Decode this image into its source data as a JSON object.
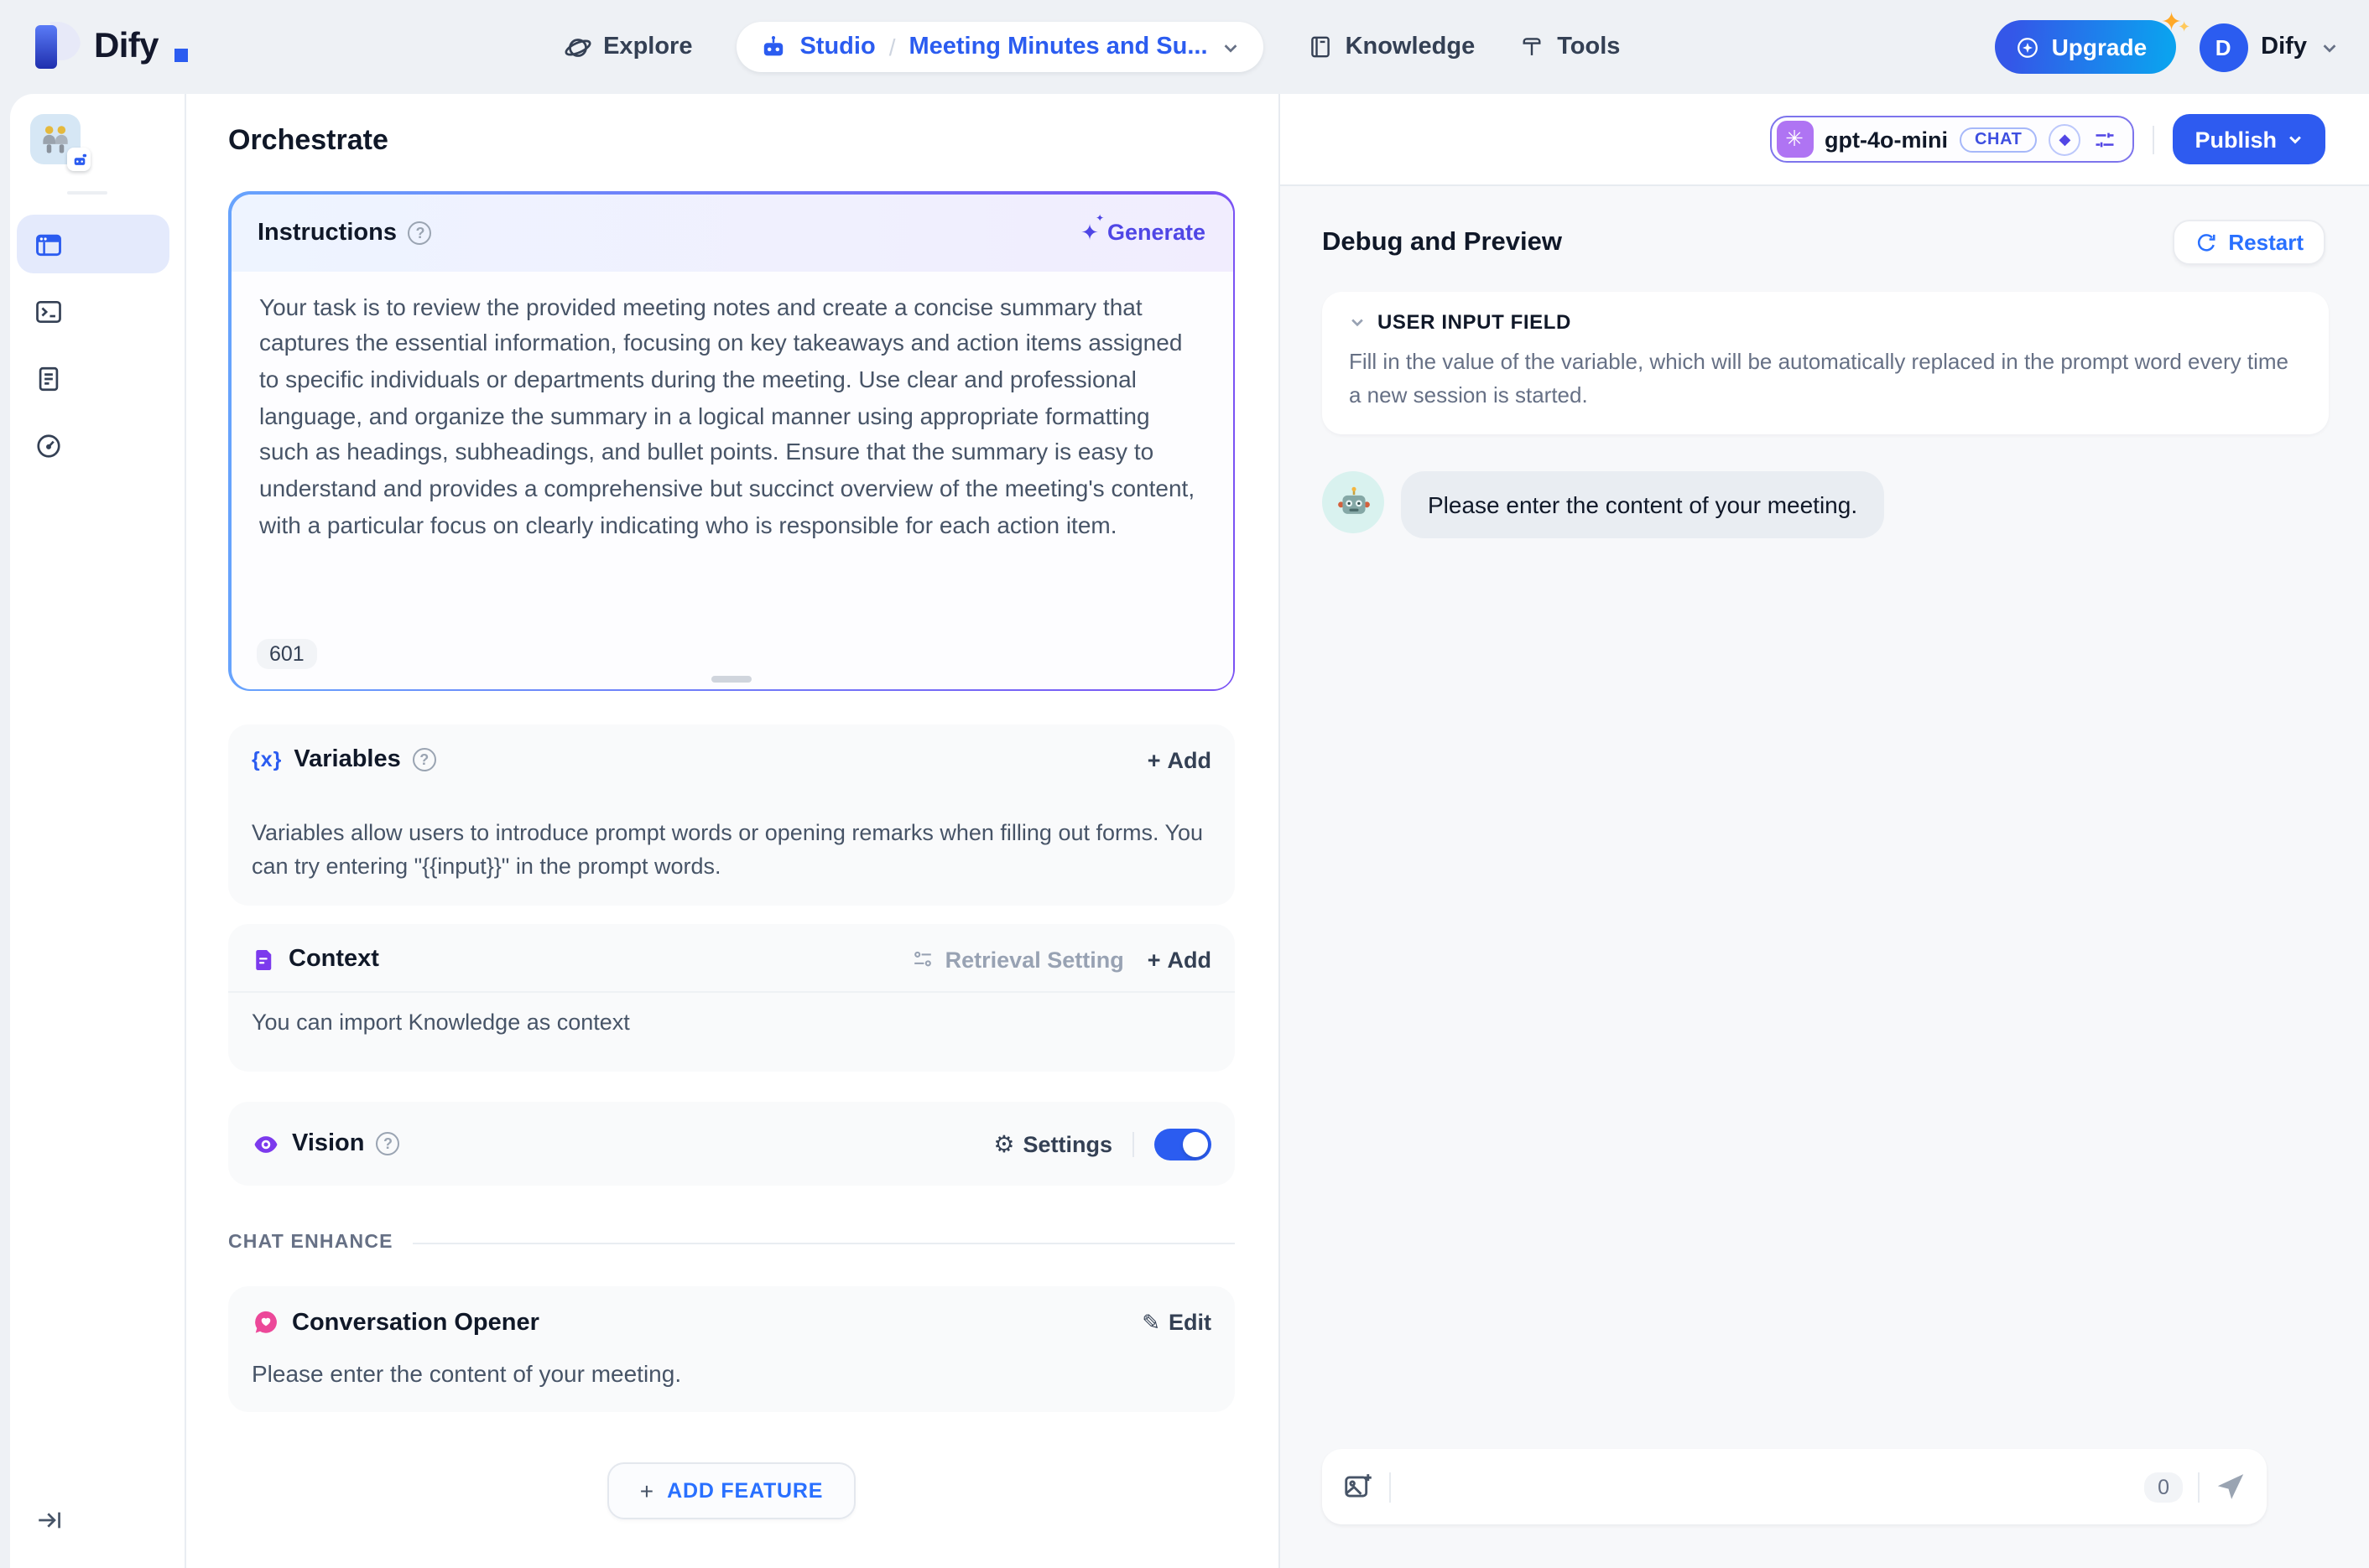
{
  "icons": {
    "help": "?",
    "sparkle": "✦",
    "gear": "⚙",
    "pencil": "✎",
    "plus": "+",
    "openai": "✳",
    "diamond": "◆",
    "var_braces": "{x}"
  },
  "header": {
    "logo_text": "Dify",
    "nav": {
      "explore": "Explore",
      "knowledge": "Knowledge",
      "tools": "Tools"
    },
    "breadcrumb": {
      "studio": "Studio",
      "separator": "/",
      "app_name": "Meeting Minutes and Su..."
    },
    "upgrade_label": "Upgrade",
    "account": {
      "initial": "D",
      "name": "Dify"
    }
  },
  "toolbar": {
    "page_title": "Orchestrate",
    "model": {
      "name": "gpt-4o-mini",
      "badge": "CHAT"
    },
    "publish_label": "Publish"
  },
  "orchestrate": {
    "instructions": {
      "title": "Instructions",
      "generate_label": "Generate",
      "prompt_text": "Your task is to review the provided meeting notes and create a concise summary that captures the essential information, focusing on key takeaways and action items assigned to specific individuals or departments during the meeting. Use clear and professional language, and organize the summary in a logical manner using appropriate formatting such as headings, subheadings, and bullet points. Ensure that the summary is easy to understand and provides a comprehensive but succinct overview of the meeting's content, with a particular focus on clearly indicating who is responsible for each action item.",
      "char_count": "601"
    },
    "variables": {
      "title": "Variables",
      "add_label": "Add",
      "description": "Variables allow users to introduce prompt words or opening remarks when filling out forms. You can try entering \"{{input}}\" in the prompt words."
    },
    "context": {
      "title": "Context",
      "retrieval_setting_label": "Retrieval Setting",
      "add_label": "Add",
      "description": "You can import Knowledge as context"
    },
    "vision": {
      "title": "Vision",
      "settings_label": "Settings",
      "enabled": true
    },
    "chat_enhance_label": "CHAT ENHANCE",
    "opener": {
      "title": "Conversation Opener",
      "edit_label": "Edit",
      "text": "Please enter the content of your meeting."
    },
    "add_feature_label": "ADD FEATURE"
  },
  "debug": {
    "title": "Debug and Preview",
    "restart_label": "Restart",
    "user_input_field": {
      "title": "USER INPUT FIELD",
      "description": "Fill in the value of the variable, which will be automatically replaced in the prompt word every time a new session is started."
    },
    "message": "Please enter the content of your meeting.",
    "input": {
      "count": "0"
    }
  },
  "colors": {
    "primary": "#2b5cf0",
    "link": "#2970ff",
    "indigo": "#5246e5",
    "purple": "#7c3aed",
    "pink": "#ec4899"
  }
}
